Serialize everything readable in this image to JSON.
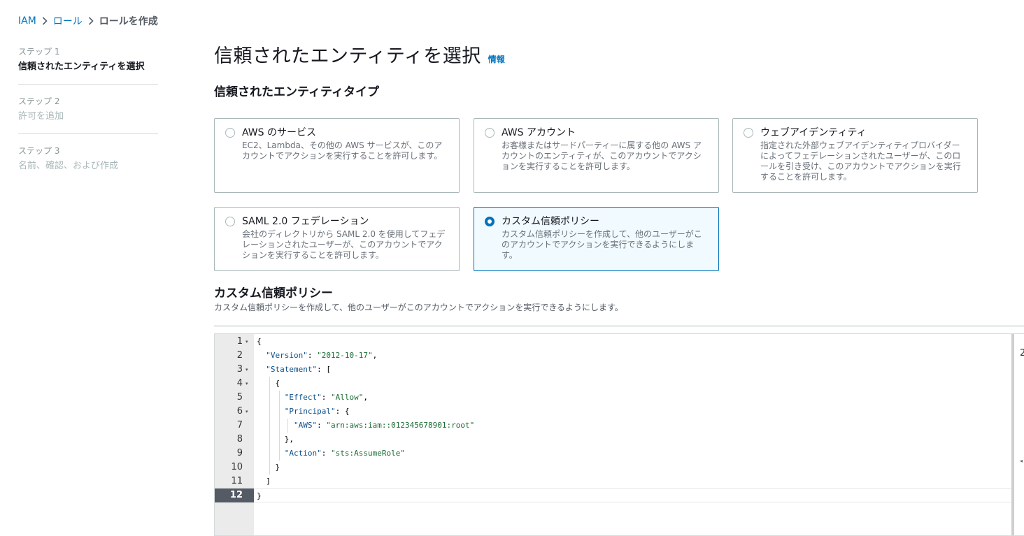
{
  "breadcrumb": {
    "items": [
      "IAM",
      "ロール"
    ],
    "current": "ロールを作成"
  },
  "steps": [
    {
      "num": "ステップ 1",
      "title": "信頼されたエンティティを選択"
    },
    {
      "num": "ステップ 2",
      "title": "許可を追加"
    },
    {
      "num": "ステップ 3",
      "title": "名前、確認、および作成"
    }
  ],
  "page": {
    "title": "信頼されたエンティティを選択",
    "info": "情報",
    "section_title": "信頼されたエンティティタイプ"
  },
  "entity_types": [
    {
      "label": "AWS のサービス",
      "desc": "EC2、Lambda、その他の AWS サービスが、このアカウントでアクションを実行することを許可します。",
      "selected": false
    },
    {
      "label": "AWS アカウント",
      "desc": "お客様またはサードパーティーに属する他の AWS アカウントのエンティティが、このアカウントでアクションを実行することを許可します。",
      "selected": false
    },
    {
      "label": "ウェブアイデンティティ",
      "desc": "指定された外部ウェブアイデンティティプロバイダーによってフェデレーションされたユーザーが、このロールを引き受け、このアカウントでアクションを実行することを許可します。",
      "selected": false
    },
    {
      "label": "SAML 2.0 フェデレーション",
      "desc": "会社のディレクトリから SAML 2.0 を使用してフェデレーションされたユーザーが、このアカウントでアクションを実行することを許可します。",
      "selected": false
    },
    {
      "label": "カスタム信頼ポリシー",
      "desc": "カスタム信頼ポリシーを作成して、他のユーザーがこのアカウントでアクションを実行できるようにします。",
      "selected": true
    }
  ],
  "custom_policy": {
    "title": "カスタム信頼ポリシー",
    "desc": "カスタム信頼ポリシーを作成して、他のユーザーがこのアカウントでアクションを実行できるようにします。"
  },
  "editor": {
    "lines": [
      "{",
      "  \"Version\": \"2012-10-17\",",
      "  \"Statement\": [",
      "    {",
      "      \"Effect\": \"Allow\",",
      "      \"Principal\": {",
      "        \"AWS\": \"arn:aws:iam::012345678901:root\"",
      "      },",
      "      \"Action\": \"sts:AssumeRole\"",
      "    }",
      "  ]",
      "}"
    ],
    "line_numbers": [
      "1",
      "2",
      "3",
      "4",
      "5",
      "6",
      "7",
      "8",
      "9",
      "10",
      "11",
      "12"
    ],
    "fold_lines": [
      1,
      3,
      4,
      6
    ],
    "active_line": 12,
    "side_mark": "2"
  },
  "colors": {
    "accent": "#0073bb",
    "selected_bg": "#f1faff"
  }
}
